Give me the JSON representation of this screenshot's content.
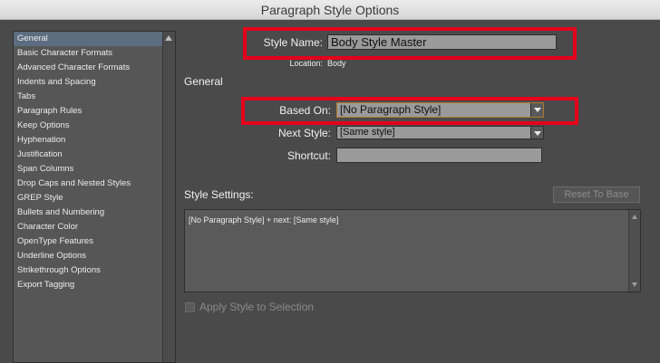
{
  "window": {
    "title": "Paragraph Style Options"
  },
  "sidebar": {
    "items": [
      {
        "label": "General",
        "selected": true
      },
      {
        "label": "Basic Character Formats"
      },
      {
        "label": "Advanced Character Formats"
      },
      {
        "label": "Indents and Spacing"
      },
      {
        "label": "Tabs"
      },
      {
        "label": "Paragraph Rules"
      },
      {
        "label": "Keep Options"
      },
      {
        "label": "Hyphenation"
      },
      {
        "label": "Justification"
      },
      {
        "label": "Span Columns"
      },
      {
        "label": "Drop Caps and Nested Styles"
      },
      {
        "label": "GREP Style"
      },
      {
        "label": "Bullets and Numbering"
      },
      {
        "label": "Character Color"
      },
      {
        "label": "OpenType Features"
      },
      {
        "label": "Underline Options"
      },
      {
        "label": "Strikethrough Options"
      },
      {
        "label": "Export Tagging"
      }
    ]
  },
  "form": {
    "style_name_label": "Style Name:",
    "style_name_value": "Body Style Master",
    "location_label": "Location:",
    "location_value": "Body",
    "general_section": "General",
    "based_on_label": "Based On:",
    "based_on_value": "[No Paragraph Style]",
    "next_style_label": "Next Style:",
    "next_style_value": "[Same style]",
    "shortcut_label": "Shortcut:",
    "shortcut_value": "",
    "style_settings_label": "Style Settings:",
    "reset_button": "Reset To Base",
    "settings_text": "[No Paragraph Style] + next: [Same style]",
    "apply_checkbox_label": "Apply Style to Selection"
  },
  "colors": {
    "highlight_box": "#e5001a",
    "selected_item": "#5d6d80"
  }
}
